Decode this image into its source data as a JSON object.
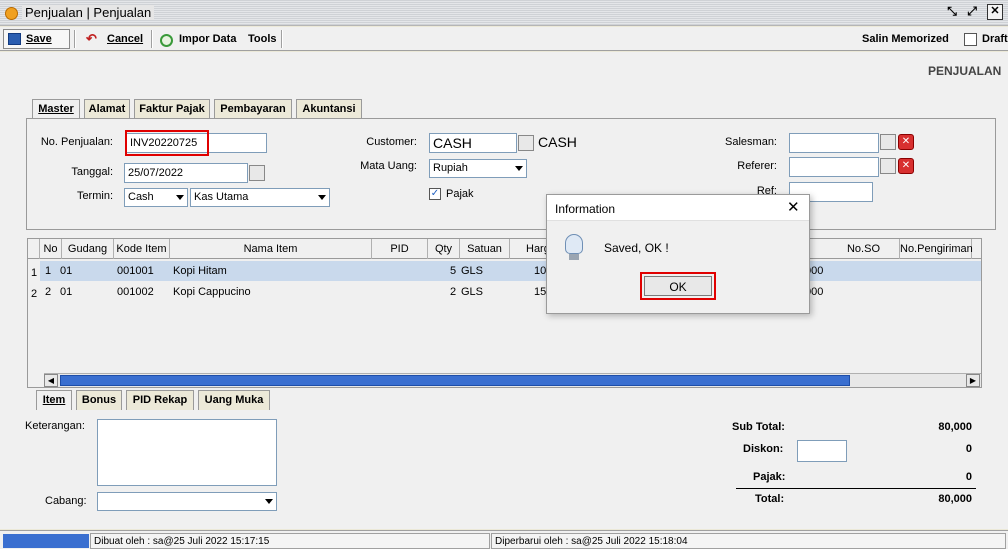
{
  "window": {
    "title": "Penjualan | Penjualan"
  },
  "toolbar": {
    "save": "Save",
    "cancel": "Cancel",
    "impor": "Impor Data",
    "tools": "Tools",
    "salin": "Salin Memorized",
    "draft": "Draft"
  },
  "header": {
    "section_title": "PENJUALAN"
  },
  "tabs": [
    "Master",
    "Alamat",
    "Faktur Pajak",
    "Pembayaran",
    "Akuntansi"
  ],
  "form": {
    "no_penjualan_label": "No. Penjualan:",
    "no_penjualan": "INV20220725",
    "tanggal_label": "Tanggal:",
    "tanggal": "25/07/2022",
    "termin_label": "Termin:",
    "termin": "Cash",
    "kas": "Kas Utama",
    "customer_label": "Customer:",
    "customer": "CASH",
    "customer_name": "CASH",
    "mata_uang_label": "Mata Uang:",
    "mata_uang": "Rupiah",
    "pajak_label": "Pajak",
    "salesman_label": "Salesman:",
    "referer_label": "Referer:",
    "ref_label": "Ref:"
  },
  "grid": {
    "columns": [
      "No",
      "Gudang",
      "Kode Item",
      "Nama Item",
      "PID",
      "Qty",
      "Satuan",
      "Harga",
      "No.SO",
      "No.Pengiriman"
    ],
    "rows": [
      {
        "row": "1",
        "no": "1",
        "gudang": "01",
        "kode": "001001",
        "nama": "Kopi Hitam",
        "qty": "5",
        "satuan": "GLS",
        "harga": "10",
        "extra": "000"
      },
      {
        "row": "2",
        "no": "2",
        "gudang": "01",
        "kode": "001002",
        "nama": "Kopi Cappucino",
        "qty": "2",
        "satuan": "GLS",
        "harga": "15",
        "extra": "000"
      }
    ]
  },
  "bottom_tabs": [
    "Item",
    "Bonus",
    "PID Rekap",
    "Uang Muka"
  ],
  "footer": {
    "keterangan_label": "Keterangan:",
    "cabang_label": "Cabang:",
    "sub_total_label": "Sub Total:",
    "sub_total": "80,000",
    "diskon_label": "Diskon:",
    "diskon": "0",
    "pajak_label": "Pajak:",
    "pajak": "0",
    "total_label": "Total:",
    "total": "80,000"
  },
  "dialog": {
    "title": "Information",
    "message": "Saved, OK !",
    "ok": "OK"
  },
  "status": {
    "dibuat": "Dibuat oleh : sa@25 Juli 2022  15:17:15",
    "diperbarui": "Diperbarui oleh : sa@25 Juli 2022  15:18:04"
  }
}
